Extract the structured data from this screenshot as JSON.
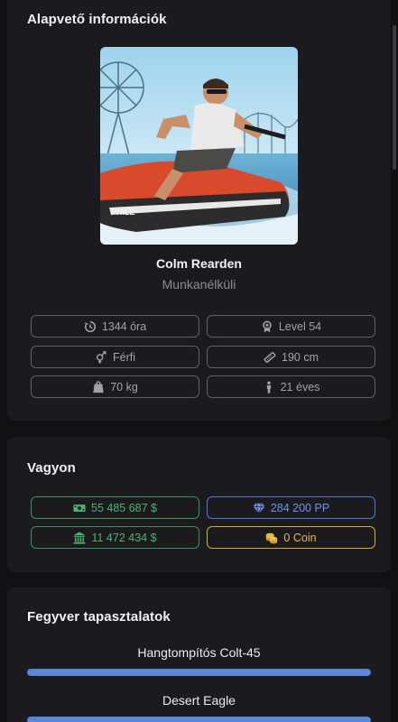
{
  "basic": {
    "title": "Alapvető információk",
    "name": "Colm Rearden",
    "job": "Munkanélküli",
    "stats": [
      {
        "icon": "history-icon",
        "value": "1344 óra"
      },
      {
        "icon": "award-icon",
        "value": "Level 54"
      },
      {
        "icon": "gender-icon",
        "value": "Férfi"
      },
      {
        "icon": "ruler-icon",
        "value": "190 cm"
      },
      {
        "icon": "weight-icon",
        "value": "70 kg"
      },
      {
        "icon": "person-icon",
        "value": "21 éves"
      }
    ]
  },
  "wealth": {
    "title": "Vagyon",
    "cash": "55 485 687 $",
    "premium": "284 200 PP",
    "bank": "11 472 434 $",
    "coin": "0 Coin",
    "colors": {
      "green": "#4fb36c",
      "blue": "#6f95ef",
      "gold": "#e8b847"
    }
  },
  "weapons": {
    "title": "Fegyver tapasztalatok",
    "items": [
      {
        "name": "Hangtompítós Colt-45",
        "progress": 1.0
      },
      {
        "name": "Desert Eagle",
        "progress": 1.0
      }
    ]
  },
  "colors": {
    "background": "#111114",
    "card": "#1b1b1f",
    "accent": "#5b86d8"
  }
}
